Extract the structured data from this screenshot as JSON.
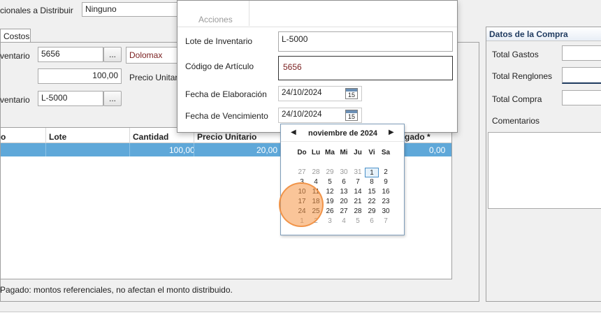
{
  "main": {
    "distrib_label": "cionales a Distribuir",
    "distrib_value": "Ninguno",
    "tab_costos": "Costos",
    "inventario_label": "ventario",
    "inventario_value": "5656",
    "browse_label": "...",
    "dolomax": "Dolomax",
    "cantidad_value": "100,00",
    "precio_unitario_label": "Precio Unitar",
    "lote_label": "ventario",
    "lote_value": "L-5000",
    "footer_note": "Pagado: montos referenciales, no afectan el monto distribuido."
  },
  "grid": {
    "headers": [
      "o",
      "Lote",
      "Cantidad",
      "Precio Unitario",
      "gado *"
    ],
    "row": {
      "cantidad": "100,00",
      "precio": "20,00",
      "pagado": "0,00"
    }
  },
  "right_panel": {
    "title": "Datos de la Compra",
    "total_gastos": "Total Gastos",
    "total_renglones": "Total Renglones",
    "total_compra": "Total Compra",
    "comentarios": "Comentarios"
  },
  "dialog": {
    "acciones": "Acciones",
    "lote_label": "Lote de Inventario",
    "lote_value": "L-5000",
    "codigo_label": "Código de Artículo",
    "codigo_value": "5656",
    "fecha_elab_label": "Fecha de Elaboración",
    "fecha_elab_value": "24/10/2024",
    "fecha_venc_label": "Fecha de Vencimiento",
    "fecha_venc_value": "24/10/2024",
    "cal_icon_text": "15"
  },
  "calendar": {
    "month_label": "noviembre de 2024",
    "prev": "◀",
    "next": "▶",
    "weekdays": [
      "Do",
      "Lu",
      "Ma",
      "Mi",
      "Ju",
      "Vi",
      "Sa"
    ],
    "days": [
      [
        "27",
        "28",
        "29",
        "30",
        "31",
        "1",
        "2"
      ],
      [
        "3",
        "4",
        "5",
        "6",
        "7",
        "8",
        "9"
      ],
      [
        "10",
        "11",
        "12",
        "13",
        "14",
        "15",
        "16"
      ],
      [
        "17",
        "18",
        "19",
        "20",
        "21",
        "22",
        "23"
      ],
      [
        "24",
        "25",
        "26",
        "27",
        "28",
        "29",
        "30"
      ],
      [
        "1",
        "2",
        "3",
        "4",
        "5",
        "6",
        "7"
      ]
    ]
  }
}
